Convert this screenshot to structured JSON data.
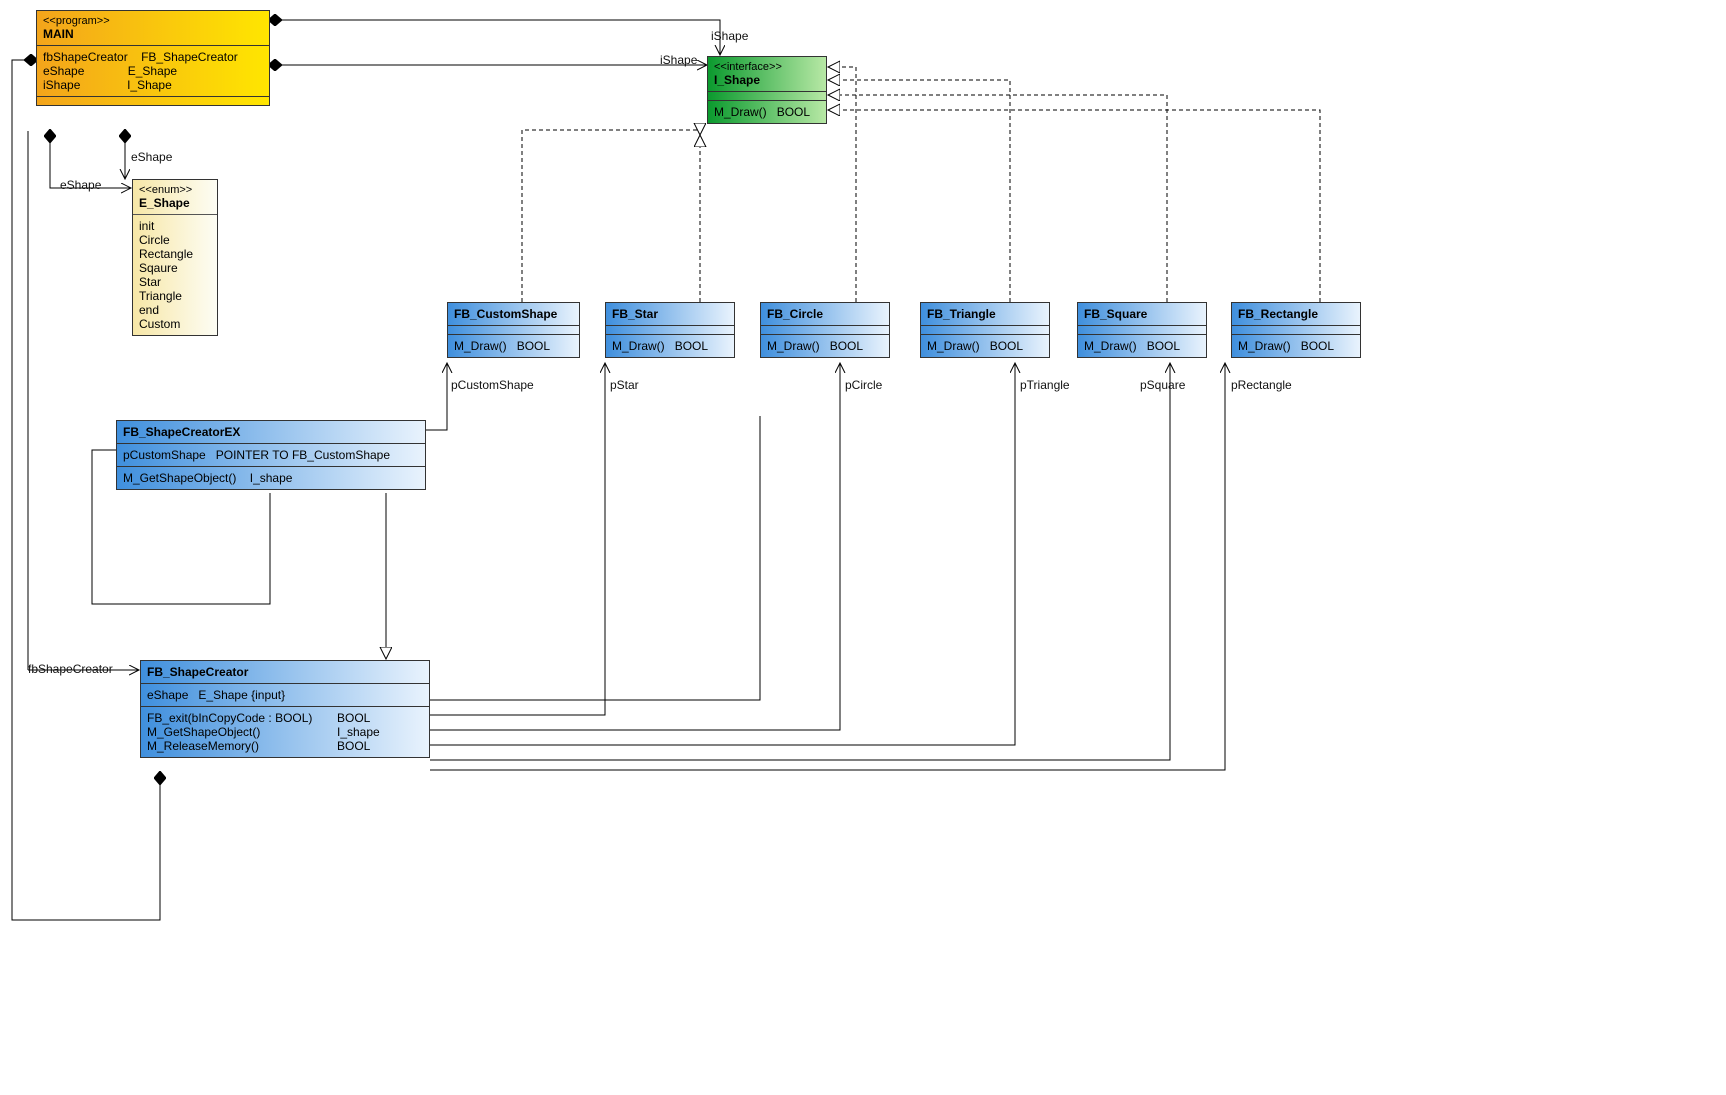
{
  "main": {
    "stereo": "<<program>>",
    "name": "MAIN",
    "attrs": [
      {
        "n": "fbShapeCreator",
        "t": "FB_ShapeCreator"
      },
      {
        "n": "eShape",
        "t": "E_Shape"
      },
      {
        "n": "iShape",
        "t": "I_Shape"
      }
    ]
  },
  "eshape": {
    "stereo": "<<enum>>",
    "name": "E_Shape",
    "values": [
      "init",
      "Circle",
      "Rectangle",
      "Sqaure",
      "Star",
      "Triangle",
      "end",
      "Custom"
    ]
  },
  "ishape": {
    "stereo": "<<interface>>",
    "name": "I_Shape",
    "ops": [
      {
        "sig": "M_Draw()",
        "ret": "BOOL"
      }
    ]
  },
  "shapes": {
    "custom": {
      "name": "FB_CustomShape",
      "op": "M_Draw()",
      "ret": "BOOL",
      "label": "pCustomShape"
    },
    "star": {
      "name": "FB_Star",
      "op": "M_Draw()",
      "ret": "BOOL",
      "label": "pStar"
    },
    "circle": {
      "name": "FB_Circle",
      "op": "M_Draw()",
      "ret": "BOOL",
      "label": "pCircle"
    },
    "triangle": {
      "name": "FB_Triangle",
      "op": "M_Draw()",
      "ret": "BOOL",
      "label": "pTriangle"
    },
    "square": {
      "name": "FB_Square",
      "op": "M_Draw()",
      "ret": "BOOL",
      "label": "pSquare"
    },
    "rect": {
      "name": "FB_Rectangle",
      "op": "M_Draw()",
      "ret": "BOOL",
      "label": "pRectangle"
    }
  },
  "fbex": {
    "name": "FB_ShapeCreatorEX",
    "attrs": [
      {
        "n": "pCustomShape",
        "t": "POINTER TO FB_CustomShape"
      }
    ],
    "ops": [
      {
        "sig": "M_GetShapeObject()",
        "ret": "I_shape"
      }
    ]
  },
  "fbcreator": {
    "name": "FB_ShapeCreator",
    "attrs": [
      {
        "n": "eShape",
        "t": "E_Shape {input}"
      }
    ],
    "ops": [
      {
        "sig": "FB_exit(bInCopyCode : BOOL)",
        "ret": "BOOL"
      },
      {
        "sig": "M_GetShapeObject()",
        "ret": "I_shape"
      },
      {
        "sig": "M_ReleaseMemory()",
        "ret": "BOOL"
      }
    ]
  },
  "labels": {
    "eShape1": "eShape",
    "eShape2": "eShape",
    "iShape1": "iShape",
    "iShape2": "iShape",
    "fbShapeCreator": "fbShapeCreator"
  }
}
